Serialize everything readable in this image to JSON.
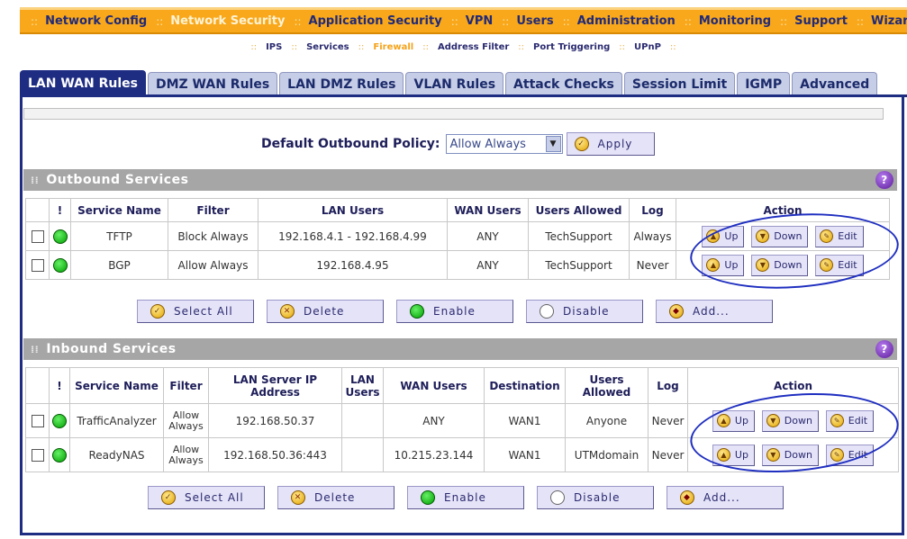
{
  "top_nav": {
    "items": [
      "Network Config",
      "Network Security",
      "Application Security",
      "VPN",
      "Users",
      "Administration",
      "Monitoring",
      "Support",
      "Wizards"
    ],
    "active": "Network Security"
  },
  "sub_nav": {
    "items": [
      "IPS",
      "Services",
      "Firewall",
      "Address Filter",
      "Port Triggering",
      "UPnP"
    ],
    "active": "Firewall"
  },
  "tabs": {
    "items": [
      "LAN WAN Rules",
      "DMZ WAN Rules",
      "LAN DMZ Rules",
      "VLAN Rules",
      "Attack Checks",
      "Session Limit",
      "IGMP",
      "Advanced"
    ],
    "active": "LAN WAN Rules"
  },
  "policy": {
    "label": "Default Outbound Policy:",
    "value": "Allow Always",
    "apply": "Apply"
  },
  "outbound": {
    "title": "Outbound Services",
    "headers": [
      "!",
      "Service Name",
      "Filter",
      "LAN Users",
      "WAN Users",
      "Users Allowed",
      "Log",
      "Action"
    ],
    "rows": [
      {
        "service": "TFTP",
        "filter": "Block Always",
        "lan_users": "192.168.4.1 - 192.168.4.99",
        "wan_users": "ANY",
        "users_allowed": "TechSupport",
        "log": "Always"
      },
      {
        "service": "BGP",
        "filter": "Allow Always",
        "lan_users": "192.168.4.95",
        "wan_users": "ANY",
        "users_allowed": "TechSupport",
        "log": "Never"
      }
    ]
  },
  "inbound": {
    "title": "Inbound Services",
    "headers": [
      "!",
      "Service Name",
      "Filter",
      "LAN Server IP Address",
      "LAN Users",
      "WAN Users",
      "Destination",
      "Users Allowed",
      "Log",
      "Action"
    ],
    "rows": [
      {
        "service": "TrafficAnalyzer",
        "filter": "Allow Always",
        "server_ip": "192.168.50.37",
        "lan_users": "",
        "wan_users": "ANY",
        "destination": "WAN1",
        "users_allowed": "Anyone",
        "log": "Never"
      },
      {
        "service": "ReadyNAS",
        "filter": "Allow Always",
        "server_ip": "192.168.50.36:443",
        "lan_users": "",
        "wan_users": "10.215.23.144",
        "destination": "WAN1",
        "users_allowed": "UTMdomain",
        "log": "Never"
      }
    ]
  },
  "action_buttons": {
    "up": "Up",
    "down": "Down",
    "edit": "Edit"
  },
  "bulk_buttons": {
    "select_all": "Select All",
    "delete": "Delete",
    "enable": "Enable",
    "disable": "Disable",
    "add": "Add..."
  },
  "colors": {
    "nav_orange": "#f8a81a",
    "tab_active": "#1e2d82",
    "section_gray": "#a6a6a6",
    "annotation_blue": "#1f2fc0"
  }
}
